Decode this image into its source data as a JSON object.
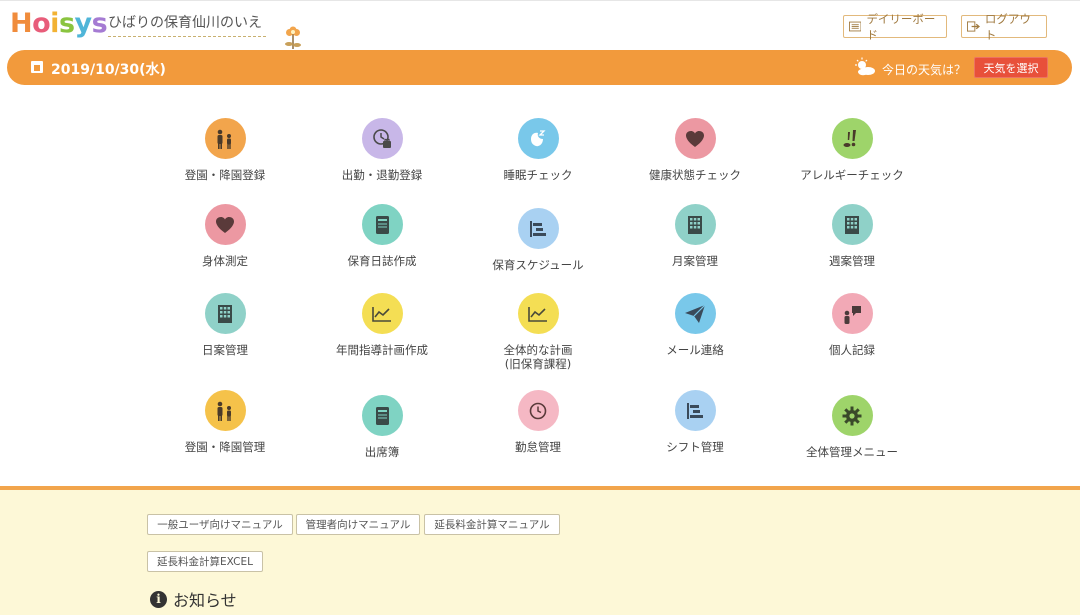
{
  "header": {
    "logo_letters": [
      "H",
      "o",
      "i",
      "s",
      "y",
      "s"
    ],
    "logo_colors": [
      "#f08c3c",
      "#e85d7a",
      "#f2b233",
      "#8ac43f",
      "#4fb5d8",
      "#a57bd3"
    ],
    "facility_name": "ひばりの保育仙川のいえ",
    "daily_board_label": "デイリーボード",
    "logout_label": "ログアウト"
  },
  "datebar": {
    "date": "2019/10/30(水)",
    "weather_prompt": "今日の天気は？",
    "weather_button": "天気を選択"
  },
  "colors": {
    "accent": "#f29a3c",
    "weather_button": "#e8503a",
    "bottom_bg": "#fdf8d7"
  },
  "menu": [
    {
      "label": "登園・降園登録",
      "icon": "family-icon",
      "color": "#f2a54c"
    },
    {
      "label": "出勤・退勤登録",
      "icon": "clock-bag-icon",
      "color": "#c8b7e8"
    },
    {
      "label": "睡眠チェック",
      "icon": "sleep-icon",
      "color": "#79c8ea"
    },
    {
      "label": "健康状態チェック",
      "icon": "heart-icon",
      "color": "#ec98a2"
    },
    {
      "label": "アレルギーチェック",
      "icon": "allergy-icon",
      "color": "#9ed46a"
    },
    {
      "label": "身体測定",
      "icon": "heart-icon",
      "color": "#ec98a2"
    },
    {
      "label": "保育日誌作成",
      "icon": "notebook-icon",
      "color": "#7fd3c3"
    },
    {
      "label": "保育スケジュール",
      "icon": "schedule-icon",
      "color": "#a9d1f2"
    },
    {
      "label": "月案管理",
      "icon": "building-icon",
      "color": "#8fd1c8"
    },
    {
      "label": "週案管理",
      "icon": "building-icon",
      "color": "#8fd1c8"
    },
    {
      "label": "日案管理",
      "icon": "building-icon",
      "color": "#8fd1c8"
    },
    {
      "label": "年間指導計画作成",
      "icon": "chart-icon",
      "color": "#f4de54"
    },
    {
      "label": "全体的な計画\n(旧保育課程)",
      "icon": "chart-icon",
      "color": "#f4de54"
    },
    {
      "label": "メール連絡",
      "icon": "paper-plane-icon",
      "color": "#79c8ea"
    },
    {
      "label": "個人記録",
      "icon": "person-speech-icon",
      "color": "#f2a9b6"
    },
    {
      "label": "登園・降園管理",
      "icon": "family-icon",
      "color": "#f5c24a"
    },
    {
      "label": "出席簿",
      "icon": "notebook-icon",
      "color": "#7fd3c3"
    },
    {
      "label": "勤怠管理",
      "icon": "clock-icon",
      "color": "#f5b8c4"
    },
    {
      "label": "シフト管理",
      "icon": "schedule-icon",
      "color": "#a9d1f2"
    },
    {
      "label": "全体管理メニュー",
      "icon": "gear-icon",
      "color": "#9ed46a"
    }
  ],
  "manuals": [
    {
      "label": "一般ユーザ向けマニュアル"
    },
    {
      "label": "管理者向けマニュアル"
    },
    {
      "label": "延長料金計算マニュアル"
    },
    {
      "label": "延長料金計算EXCEL"
    }
  ],
  "notice": {
    "title": "お知らせ"
  }
}
